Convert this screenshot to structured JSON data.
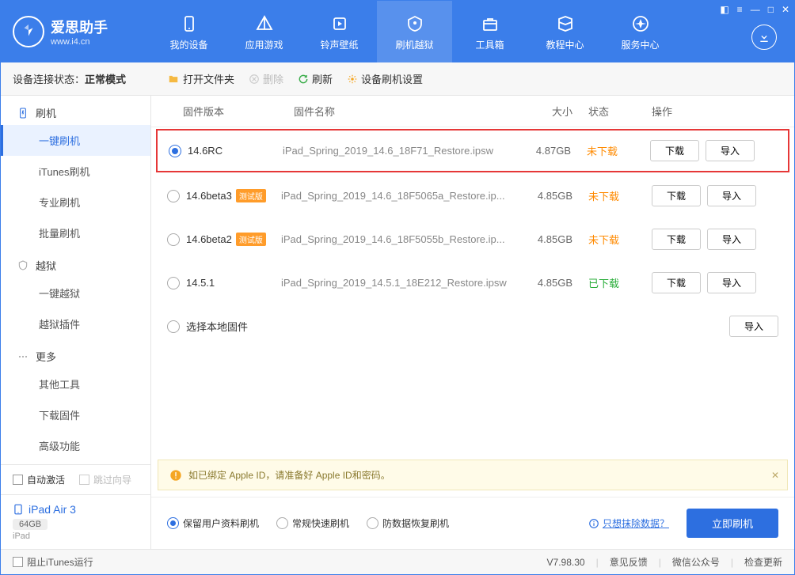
{
  "app": {
    "title": "爱思助手",
    "url": "www.i4.cn"
  },
  "nav": [
    {
      "label": "我的设备"
    },
    {
      "label": "应用游戏"
    },
    {
      "label": "铃声壁纸"
    },
    {
      "label": "刷机越狱",
      "active": true
    },
    {
      "label": "工具箱"
    },
    {
      "label": "教程中心"
    },
    {
      "label": "服务中心"
    }
  ],
  "status": {
    "prefix": "设备连接状态：",
    "mode": "正常模式"
  },
  "toolbar": {
    "open_folder": "打开文件夹",
    "delete": "删除",
    "refresh": "刷新",
    "settings": "设备刷机设置"
  },
  "sidebar": {
    "sections": [
      {
        "icon": "flash",
        "label": "刷机",
        "items": [
          {
            "label": "一键刷机",
            "active": true
          },
          {
            "label": "iTunes刷机"
          },
          {
            "label": "专业刷机"
          },
          {
            "label": "批量刷机"
          }
        ]
      },
      {
        "icon": "shield",
        "label": "越狱",
        "items": [
          {
            "label": "一键越狱"
          },
          {
            "label": "越狱插件"
          }
        ]
      },
      {
        "icon": "more",
        "label": "更多",
        "items": [
          {
            "label": "其他工具"
          },
          {
            "label": "下载固件"
          },
          {
            "label": "高级功能"
          }
        ]
      }
    ],
    "auto_activate": "自动激活",
    "skip_wizard": "跳过向导"
  },
  "device": {
    "name": "iPad Air 3",
    "storage": "64GB",
    "type": "iPad"
  },
  "table": {
    "headers": {
      "version": "固件版本",
      "name": "固件名称",
      "size": "大小",
      "status": "状态",
      "ops": "操作"
    },
    "download_btn": "下载",
    "import_btn": "导入",
    "beta_badge": "测试版",
    "rows": [
      {
        "selected": true,
        "version": "14.6RC",
        "beta": false,
        "name": "iPad_Spring_2019_14.6_18F71_Restore.ipsw",
        "size": "4.87GB",
        "status": "未下载",
        "downloaded": false
      },
      {
        "selected": false,
        "version": "14.6beta3",
        "beta": true,
        "name": "iPad_Spring_2019_14.6_18F5065a_Restore.ip...",
        "size": "4.85GB",
        "status": "未下载",
        "downloaded": false
      },
      {
        "selected": false,
        "version": "14.6beta2",
        "beta": true,
        "name": "iPad_Spring_2019_14.6_18F5055b_Restore.ip...",
        "size": "4.85GB",
        "status": "未下载",
        "downloaded": false
      },
      {
        "selected": false,
        "version": "14.5.1",
        "beta": false,
        "name": "iPad_Spring_2019_14.5.1_18E212_Restore.ipsw",
        "size": "4.85GB",
        "status": "已下载",
        "downloaded": true
      }
    ],
    "local_row": "选择本地固件"
  },
  "notice": "如已绑定 Apple ID，请准备好 Apple ID和密码。",
  "flashbar": {
    "opt_keep": "保留用户资料刷机",
    "opt_normal": "常规快速刷机",
    "opt_antiloss": "防数据恢复刷机",
    "only_erase": "只想抹除数据？",
    "flash_now": "立即刷机"
  },
  "footer": {
    "block_itunes": "阻止iTunes运行",
    "version": "V7.98.30",
    "feedback": "意见反馈",
    "wechat": "微信公众号",
    "check_update": "检查更新"
  }
}
